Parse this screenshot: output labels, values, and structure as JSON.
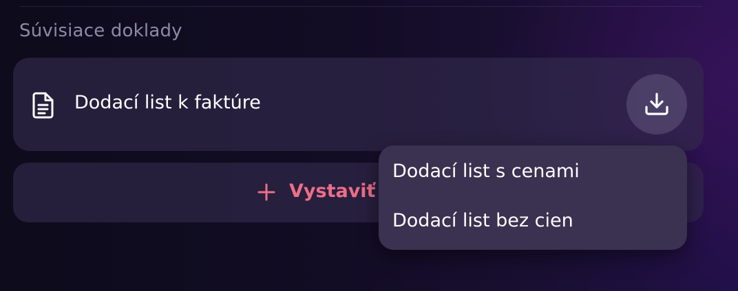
{
  "section": {
    "title": "Súvisiace doklady"
  },
  "document": {
    "name": "Dodací list k faktúre",
    "icon": "document-icon",
    "download_icon": "download-icon"
  },
  "issue_button": {
    "label": "Vystaviť d",
    "icon": "plus-icon"
  },
  "download_menu": {
    "items": [
      {
        "label": "Dodací list s cenami"
      },
      {
        "label": "Dodací list bez cien"
      }
    ]
  },
  "colors": {
    "accent": "#ec6f87",
    "card": "#2f2846",
    "menu": "#3b3150",
    "muted_text": "#8e8aa6"
  }
}
